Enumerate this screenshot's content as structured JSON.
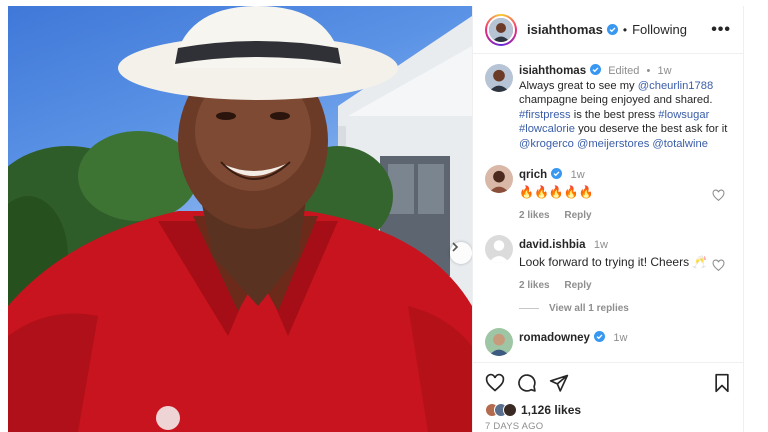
{
  "post": {
    "image_alt": "Smiling man in white fedora and red polo shirt",
    "next_icon": "chevron-right-icon"
  },
  "header": {
    "username": "isiahthomas",
    "separator": "•",
    "follow_status": "Following",
    "more": "•••"
  },
  "caption": {
    "username": "isiahthomas",
    "edited": "Edited",
    "separator": "•",
    "time": "1w",
    "parts": {
      "t1": "Always great to see my ",
      "m1": "@cheurlin1788",
      "t2": " champagne being enjoyed and shared. ",
      "h1": "#firstpress",
      "t3": " is the best press ",
      "h2": "#lowsugar",
      "t4": " ",
      "h3": "#lowcalorie",
      "t5": " you deserve the best ask for it ",
      "m2": "@krogerco",
      "t6": " ",
      "m3": "@meijerstores",
      "t7": " ",
      "m4": "@totalwine"
    }
  },
  "comments": [
    {
      "username": "qrich",
      "verified": true,
      "time": "1w",
      "text": "🔥🔥🔥🔥🔥",
      "likes": "2 likes",
      "reply": "Reply"
    },
    {
      "username": "david.ishbia",
      "verified": false,
      "time": "1w",
      "text": "Look forward to trying it! Cheers 🥂",
      "likes": "2 likes",
      "reply": "Reply",
      "view_replies": "View all 1 replies"
    },
    {
      "username": "romadowney",
      "verified": true,
      "time": "1w"
    }
  ],
  "footer": {
    "likes": "1,126 likes",
    "posted": "7 DAYS AGO",
    "icons": [
      "heart-icon",
      "comment-icon",
      "share-icon",
      "bookmark-icon"
    ]
  },
  "colors": {
    "verified": "#3897f0",
    "link": "#3b5ea8",
    "muted": "#8e8e8e",
    "shirt": "#c8141e",
    "sky": "#4a86df"
  }
}
